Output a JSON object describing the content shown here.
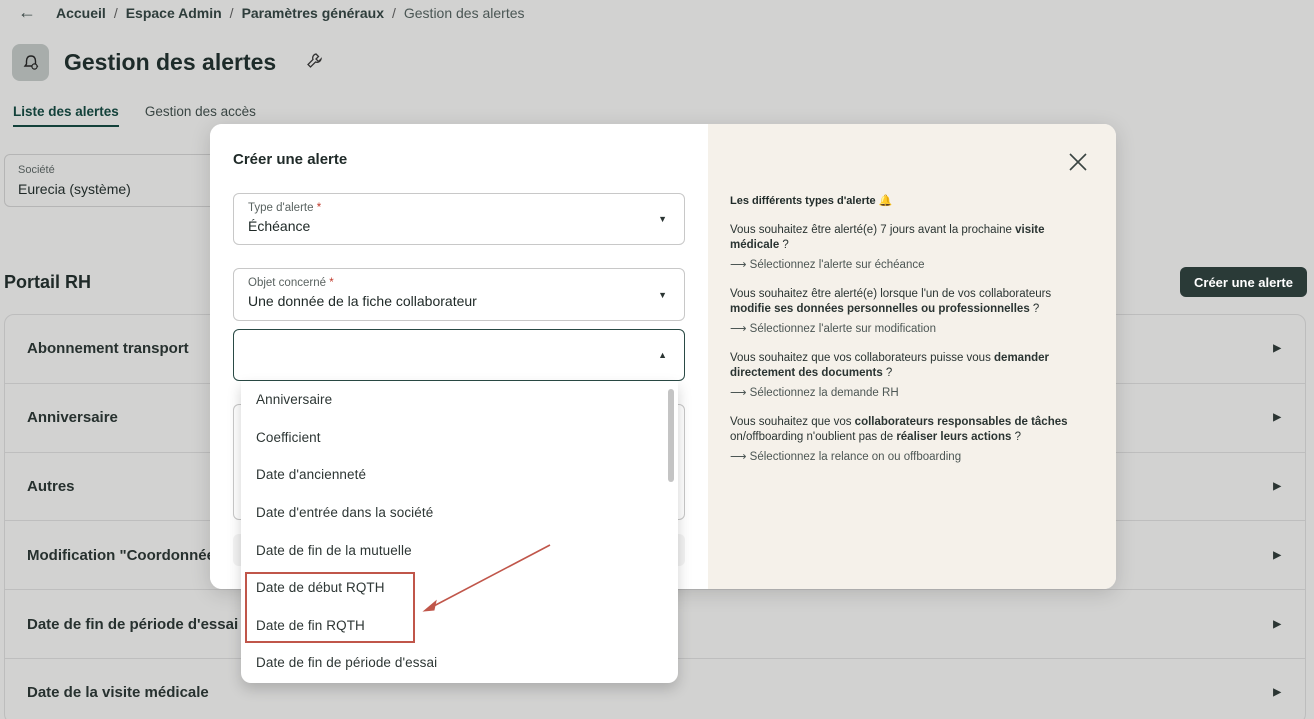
{
  "breadcrumb": {
    "back_glyph": "←",
    "items": [
      "Accueil",
      "Espace Admin",
      "Paramètres généraux"
    ],
    "current": "Gestion des alertes"
  },
  "header": {
    "title": "Gestion des alertes",
    "icon": "bell-gear-icon",
    "wrench_icon": "wrench-icon"
  },
  "tabs": [
    {
      "label": "Liste des alertes",
      "active": true
    },
    {
      "label": "Gestion des accès",
      "active": false
    }
  ],
  "company_filter": {
    "label": "Société",
    "value": "Eurecia (système)"
  },
  "section": {
    "title": "Portail RH",
    "create_button": "Créer une alerte"
  },
  "alert_rows": [
    "Abonnement transport",
    "Anniversaire",
    "Autres",
    "Modification \"Coordonnées",
    "Date de fin de période d'essai",
    "Date de la visite médicale"
  ],
  "modal": {
    "title": "Créer une alerte",
    "type_field": {
      "label": "Type d'alerte",
      "required": "*",
      "value": "Échéance"
    },
    "object_field": {
      "label": "Objet concerné",
      "required": "*",
      "value": "Une donnée de la fiche collaborateur"
    },
    "data_field": {
      "value": ""
    },
    "info": {
      "heading": "Les différents types d'alerte 🔔",
      "blocks": [
        {
          "pre": "Vous souhaitez être alerté(e) 7 jours avant la prochaine ",
          "bold": "visite médicale",
          "post": " ?",
          "link": "⟶  Sélectionnez l'alerte sur échéance"
        },
        {
          "pre": "Vous souhaitez être alerté(e) lorsque l'un de vos collaborateurs ",
          "bold": "modifie ses données personnelles ou professionnelles",
          "post": " ?",
          "link": "⟶  Sélectionnez l'alerte sur modification"
        },
        {
          "pre": "Vous souhaitez que vos collaborateurs puisse vous ",
          "bold": "demander directement des documents",
          "post": " ?",
          "link": "⟶  Sélectionnez la demande RH"
        },
        {
          "pre": "Vous souhaitez que vos ",
          "bold": "collaborateurs responsables de tâches",
          "mid": " on/offboarding n'oublient pas de ",
          "bold2": "réaliser leurs actions",
          "post": " ?",
          "link": "⟶  Sélectionnez la relance on ou offboarding"
        }
      ]
    }
  },
  "dropdown_options": [
    "Anniversaire",
    "Coefficient",
    "Date d'ancienneté",
    "Date d'entrée dans la société",
    "Date de fin de la mutuelle",
    "Date de début RQTH",
    "Date de fin RQTH",
    "Date de fin de période d'essai"
  ],
  "colors": {
    "accent": "#13413a",
    "annotation": "#c0564a",
    "info_panel": "#f5f1ea",
    "dim_background": "#d2d2d1"
  }
}
